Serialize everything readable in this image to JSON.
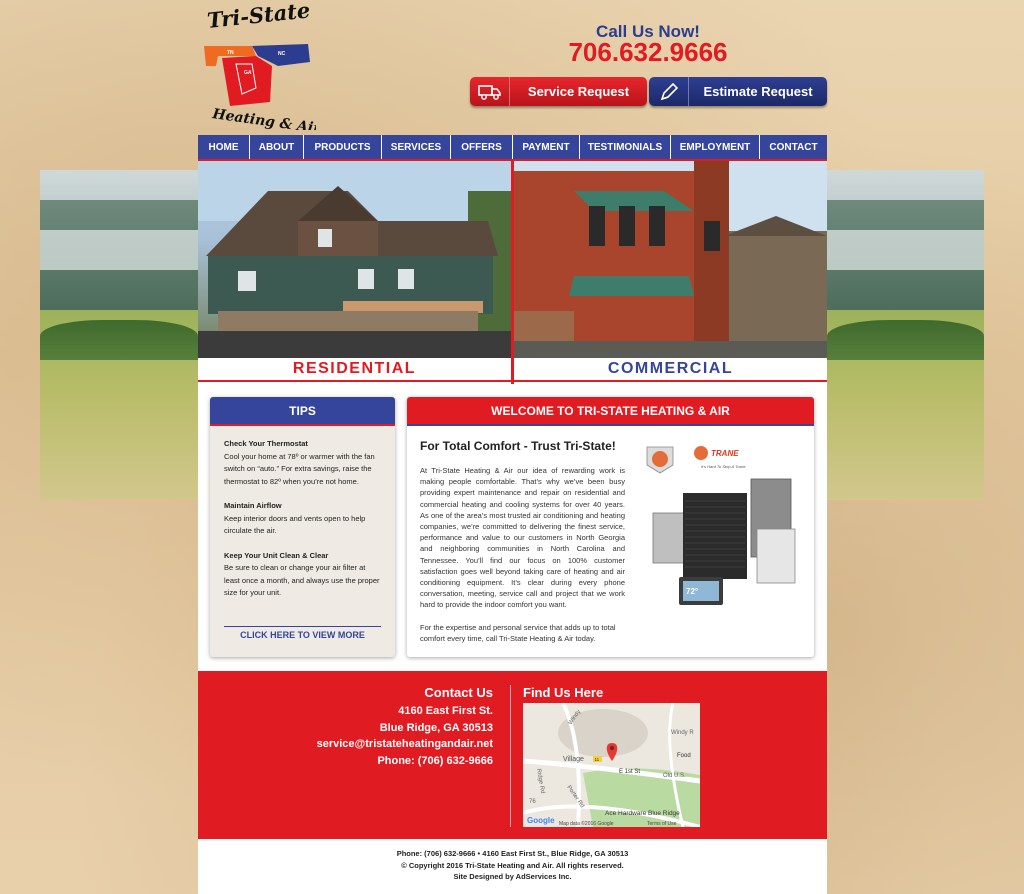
{
  "header": {
    "logo_text_top": "Tri-State",
    "logo_text_bottom": "Heating & Air",
    "logo_states": [
      "TN",
      "NC",
      "GA"
    ],
    "call_label": "Call Us Now!",
    "phone": "706.632.9666",
    "service_button": "Service Request",
    "estimate_button": "Estimate Request"
  },
  "nav": [
    {
      "label": "HOME"
    },
    {
      "label": "ABOUT"
    },
    {
      "label": "PRODUCTS"
    },
    {
      "label": "SERVICES"
    },
    {
      "label": "OFFERS"
    },
    {
      "label": "PAYMENT"
    },
    {
      "label": "TESTIMONIALS"
    },
    {
      "label": "EMPLOYMENT"
    },
    {
      "label": "CONTACT"
    }
  ],
  "hero": {
    "residential": "RESIDENTIAL",
    "commercial": "COMMERCIAL"
  },
  "tips": {
    "title": "TIPS",
    "items": [
      {
        "title": "Check Your Thermostat",
        "text": "Cool your home at 78º or warmer with the fan switch on “auto.” For extra savings, raise the thermostat to 82º when you’re not home."
      },
      {
        "title": "Maintain Airflow",
        "text": "Keep interior doors and vents open to help circulate the air."
      },
      {
        "title": "Keep Your Unit Clean & Clear",
        "text": "Be sure to clean or change your air filter at least once a month, and always use the proper size for your unit."
      }
    ],
    "link": "CLICK HERE TO VIEW MORE"
  },
  "welcome": {
    "title": "WELCOME TO TRI-STATE HEATING & AIR",
    "subtitle": "For Total Comfort - Trust Tri-State!",
    "paragraph1": "At Tri-State Heating & Air our idea of rewarding work is making people comfortable. That’s why we’ve been busy providing expert maintenance and repair on residential and commercial heating and cooling systems for over 40 years. As one of the area’s most trusted air conditioning and heating companies, we’re committed to delivering the finest service, performance and value to our customers in North Georgia and neighboring communities in North Carolina and Tennessee. You’ll find our focus on 100% customer satisfaction goes well beyond taking care of heating and air conditioning equipment. It’s clear during every phone conversation, meeting, service call and project that we work hard to provide the indoor comfort you want.",
    "paragraph2": "For the expertise and personal service that adds up to total comfort every time, call Tri-State Heating & Air today.",
    "brand": "TRANE",
    "brand_tagline": "It’s Hard To Stop A Trane.",
    "thermostat_reading": "72°"
  },
  "contact": {
    "title": "Contact Us",
    "street": "4160 East First St.",
    "city": "Blue Ridge, GA 30513",
    "email": "service@tristateheatingandair.net",
    "phone": "Phone: (706) 632-9666"
  },
  "map": {
    "title": "Find Us Here",
    "labels": {
      "windy": "Windy",
      "windy_right": "Windy R",
      "food": "Food",
      "village": "Village",
      "first_st": "E 1st St",
      "old_us": "Old U.S.",
      "ridge_rd": "Ridge Rd",
      "porter_rd": "Porter Rd",
      "route": "76",
      "route_shield": "11",
      "ace": "Ace Hardware Blue Ridge"
    },
    "attribution": "Map data ©2016 Google",
    "terms": "Terms of Use",
    "google": "Google"
  },
  "footer": {
    "line1": "Phone: (706) 632-9666 • 4160 East First St., Blue Ridge, GA 30513",
    "line2": "© Copyright 2016 Tri-State Heating and Air. All rights reserved.",
    "line3": "Site Designed by AdServices Inc."
  }
}
